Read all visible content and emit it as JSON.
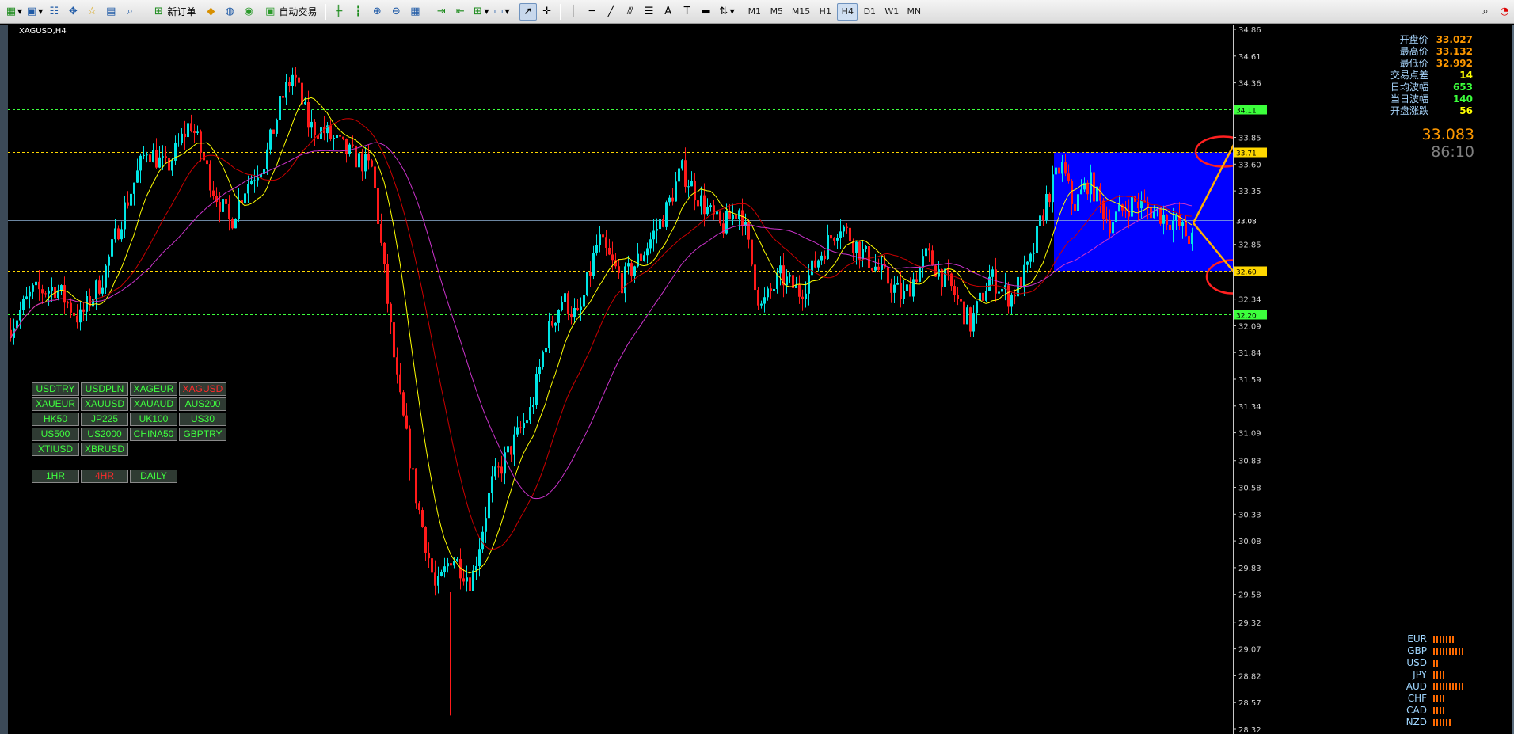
{
  "toolbar": {
    "new_order_label": "新订单",
    "auto_trade_label": "自动交易",
    "timeframes": [
      "M1",
      "M5",
      "M15",
      "H1",
      "H4",
      "D1",
      "W1",
      "MN"
    ],
    "active_timeframe": "H4"
  },
  "chart": {
    "symbol_title": "XAGUSD,H4",
    "big_price": "33.083",
    "countdown": "86:10",
    "price_axis": {
      "labels": [
        "34.86",
        "34.61",
        "34.36",
        "34.11",
        "33.85",
        "33.60",
        "33.35",
        "33.08",
        "32.85",
        "32.60",
        "32.34",
        "32.09",
        "31.84",
        "31.59",
        "31.34",
        "31.09",
        "30.83",
        "30.58",
        "30.33",
        "30.08",
        "29.83",
        "29.58",
        "29.32",
        "29.07",
        "28.82",
        "28.57",
        "28.32"
      ],
      "ymax": 34.86,
      "ymin": 28.32
    },
    "hlines": [
      {
        "price": 34.11,
        "label": "34.11",
        "color": "#3cff3c"
      },
      {
        "price": 33.71,
        "label": "33.71",
        "color": "#ffd700"
      },
      {
        "price": 33.08,
        "label": "33.08",
        "color": "#8fb3d8"
      },
      {
        "price": 32.6,
        "label": "32.60",
        "color": "#ffd700"
      },
      {
        "price": 32.2,
        "label": "32.20",
        "color": "#3cff3c"
      }
    ],
    "colors": {
      "up": "#00e5e5",
      "down": "#ff1a1a",
      "ma_fast": "#ffff00",
      "ma_mid": "#cc0000",
      "ma_slow": "#cc33cc",
      "box": "#0000ff"
    }
  },
  "info_panel": [
    {
      "label": "开盘价",
      "value": "33.027",
      "color": "#ff9900"
    },
    {
      "label": "最高价",
      "value": "33.132",
      "color": "#ff9900"
    },
    {
      "label": "最低价",
      "value": "32.992",
      "color": "#ff9900"
    },
    {
      "label": "交易点差",
      "value": "14",
      "color": "#ffff00"
    },
    {
      "label": "日均波幅",
      "value": "653",
      "color": "#3cff3c"
    },
    {
      "label": "当日波幅",
      "value": "140",
      "color": "#3cff3c"
    },
    {
      "label": "开盘涨跌",
      "value": "56",
      "color": "#ffff00"
    }
  ],
  "symbol_buttons": [
    "USDTRY",
    "USDPLN",
    "XAGEUR",
    "XAGUSD",
    "XAUEUR",
    "XAUUSD",
    "XAUAUD",
    "AUS200",
    "HK50",
    "JP225",
    "UK100",
    "US30",
    "US500",
    "US2000",
    "CHINA50",
    "GBPTRY",
    "XTIUSD",
    "XBRUSD"
  ],
  "active_symbol": "XAGUSD",
  "timeframe_buttons": [
    "1HR",
    "4HR",
    "DAILY"
  ],
  "active_tf_button": "4HR",
  "currency_strength": [
    {
      "name": "EUR",
      "bars": 7
    },
    {
      "name": "GBP",
      "bars": 10
    },
    {
      "name": "USD",
      "bars": 2
    },
    {
      "name": "JPY",
      "bars": 4
    },
    {
      "name": "AUD",
      "bars": 10
    },
    {
      "name": "CHF",
      "bars": 4
    },
    {
      "name": "CAD",
      "bars": 4
    },
    {
      "name": "NZD",
      "bars": 6
    }
  ]
}
